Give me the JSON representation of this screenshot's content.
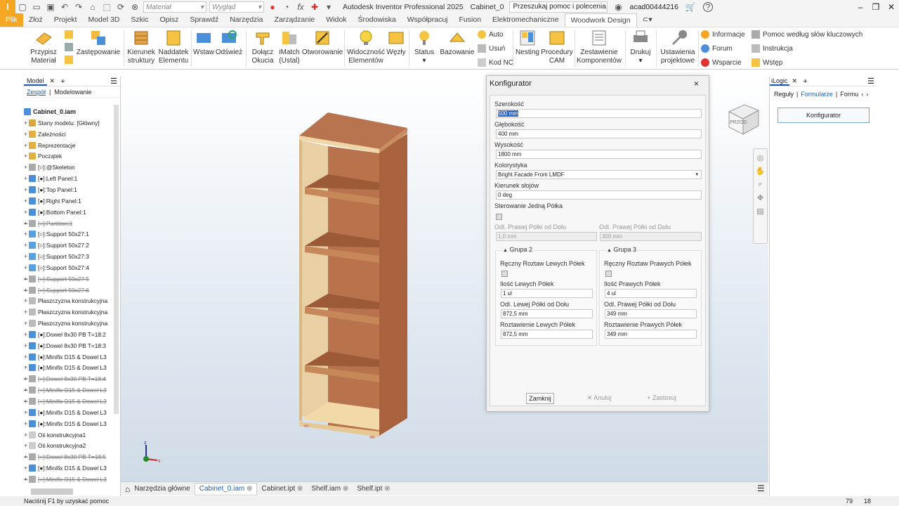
{
  "qat": {
    "logo": "I",
    "material": "Materiał",
    "appearance": "Wygląd",
    "title": "Autodesk Inventor Professional 2025",
    "doc": "Cabinet_0",
    "search": "Przeszukaj pomoc i polecenia...",
    "user": "acad00444216",
    "help": "?"
  },
  "tabs": [
    "Plik",
    "Złoż",
    "Projekt",
    "Model 3D",
    "Szkic",
    "Opisz",
    "Sprawdź",
    "Narzędzia",
    "Zarządzanie",
    "Widok",
    "Środowiska",
    "Współpracuj",
    "Fusion",
    "Elektromechaniczne",
    "Woodwork Design"
  ],
  "ribbon": {
    "przypisz": "Przypisz Materiał",
    "zastepowanie": "Zastępowanie",
    "kierunek": "Kierunek struktury",
    "naddatek": "Naddatek Elementu",
    "wstaw": "Wstaw",
    "odswiez": "Odśwież",
    "dolacz": "Dołącz Okucia",
    "imatch": "iMatch (Ustal)",
    "otworowanie": "Otworowanie",
    "widocznosc": "Widoczność Elementów",
    "wezly": "Węzły",
    "status": "Status",
    "bazowanie": "Bazowanie",
    "auto": "Auto",
    "usun": "Usuń",
    "kodnc": "Kod NC",
    "nesting": "Nesting",
    "procedury": "Procedury CAM",
    "zestawienie": "Zestawienie Komponentów",
    "drukuj": "Drukuj",
    "ustawienia": "Ustawienia projektowe",
    "informacje": "Informacje",
    "forum": "Forum",
    "wsparcie": "Wsparcie",
    "pomoc": "Pomoc według słów kluczowych",
    "instrukcja": "Instrukcja",
    "wstep": "Wstęp"
  },
  "left": {
    "tab": "Model",
    "plus": "+",
    "sub1": "Zespół",
    "sub2": "Modelowanie",
    "root": "Cabinet_0.iam",
    "items": [
      {
        "t": "Stany modelu: [Główny]",
        "s": false,
        "c": "#d8a840"
      },
      {
        "t": "Zależności",
        "s": false,
        "c": "#e0b040"
      },
      {
        "t": "Reprezentacje",
        "s": false,
        "c": "#e0b040"
      },
      {
        "t": "Początek",
        "s": false,
        "c": "#e0b040"
      },
      {
        "t": "[○]:@Skeleton",
        "s": false,
        "c": "#aaa"
      },
      {
        "t": "[●]:Left Panel:1",
        "s": false,
        "c": "#4a8fd8"
      },
      {
        "t": "[●]:Top Panel:1",
        "s": false,
        "c": "#4a8fd8"
      },
      {
        "t": "[●]:Right Panel:1",
        "s": false,
        "c": "#4a8fd8"
      },
      {
        "t": "[●]:Bottom Panel:1",
        "s": false,
        "c": "#4a8fd8"
      },
      {
        "t": "[○]:Partition:1",
        "s": true,
        "c": "#aaa"
      },
      {
        "t": "[○]:Support 50x27:1",
        "s": false,
        "c": "#5aa0e0"
      },
      {
        "t": "[○]:Support 50x27:2",
        "s": false,
        "c": "#5aa0e0"
      },
      {
        "t": "[○]:Support 50x27:3",
        "s": false,
        "c": "#5aa0e0"
      },
      {
        "t": "[○]:Support 50x27:4",
        "s": false,
        "c": "#5aa0e0"
      },
      {
        "t": "[○]:Support 50x27:5",
        "s": true,
        "c": "#aaa"
      },
      {
        "t": "[○]:Support 50x27:6",
        "s": true,
        "c": "#aaa"
      },
      {
        "t": "Płaszczyzna konstrukcyjna",
        "s": false,
        "c": "#bbb"
      },
      {
        "t": "Płaszczyzna konstrukcyjna",
        "s": false,
        "c": "#bbb"
      },
      {
        "t": "Płaszczyzna konstrukcyjna",
        "s": false,
        "c": "#bbb"
      },
      {
        "t": "[●]:Dowel 8x30 PB T=18:2",
        "s": false,
        "c": "#4a8fd8"
      },
      {
        "t": "[●]:Dowel 8x30 PB T=18:3",
        "s": false,
        "c": "#4a8fd8"
      },
      {
        "t": "[●]:Minifix D15 & Dowel L3",
        "s": false,
        "c": "#4a8fd8"
      },
      {
        "t": "[●]:Minifix D15 & Dowel L3",
        "s": false,
        "c": "#4a8fd8"
      },
      {
        "t": "[○]:Dowel 8x30 PB T=18:4",
        "s": true,
        "c": "#aaa"
      },
      {
        "t": "[○]:Minifix D15 & Dowel L3",
        "s": true,
        "c": "#aaa"
      },
      {
        "t": "[○]:Minifix D15 & Dowel L3",
        "s": true,
        "c": "#aaa"
      },
      {
        "t": "[●]:Minifix D15 & Dowel L3",
        "s": false,
        "c": "#4a8fd8"
      },
      {
        "t": "[●]:Minifix D15 & Dowel L3",
        "s": false,
        "c": "#4a8fd8"
      },
      {
        "t": "Oś konstrukcyjna1",
        "s": false,
        "c": "#ccc"
      },
      {
        "t": "Oś konstrukcyjna2",
        "s": false,
        "c": "#ccc"
      },
      {
        "t": "[○]:Dowel 8x30 PB T=18:5",
        "s": true,
        "c": "#aaa"
      },
      {
        "t": "[●]:Minifix D15 & Dowel L3",
        "s": false,
        "c": "#4a8fd8"
      },
      {
        "t": "[○]:Minifix D15 & Dowel L3",
        "s": true,
        "c": "#aaa"
      }
    ]
  },
  "dialog": {
    "title": "Konfigurator",
    "close": "×",
    "szer_l": "Szerokość",
    "szer_v": "500 mm",
    "gleb_l": "Głębokość",
    "gleb_v": "400 mm",
    "wys_l": "Wysokość",
    "wys_v": "1800 mm",
    "kol_l": "Kolorystyka",
    "kol_v": "Bright Facade From LMDF",
    "kier_l": "Kierunek słojów",
    "kier_v": "0 deg",
    "ster_l": "Sterowanie Jedną Półka",
    "odl1_l": "Odl. Prawej Półki od Dołu",
    "odl1_v": "1,0 mm",
    "odl2_l": "Odl. Prawej Półki od Dołu",
    "odl2_v": "300 mm",
    "g2": "Grupa 2",
    "g3": "Grupa 3",
    "g2_rr": "Ręczny Roztaw Lewych Półek",
    "g2_il": "Ilość Lewych Półek",
    "g2_il_v": "1 ul",
    "g2_od": "Odl. Lewej Półki od Dołu",
    "g2_od_v": "872,5 mm",
    "g2_rz": "Roztawienie Lewych Półek",
    "g2_rz_v": "872,5 mm",
    "g3_rr": "Ręczny Roztaw Prawych Półek",
    "g3_il": "Ilość Prawych Półek",
    "g3_il_v": "4 ul",
    "g3_od": "Odl. Prawej Półki od Dołu",
    "g3_od_v": "349 mm",
    "g3_rz": "Roztawienie Prawych Półek",
    "g3_rz_v": "349 mm",
    "zamknij": "Zamknij",
    "anuluj": "Anuluj",
    "zastosuj": "Zastosuj"
  },
  "right": {
    "tab": "iLogic",
    "plus": "+",
    "t1": "Reguły",
    "t2": "Formularze",
    "t3": "Formu",
    "btn": "Konfigurator"
  },
  "viewcube": {
    "label": "PRZÓD"
  },
  "btabs": [
    "Narzędzia główne",
    "Cabinet_0.iam",
    "Cabinet.ipt",
    "Shelf.iam",
    "Shelf.ipt"
  ],
  "status": {
    "text": "Naciśnij F1 by uzyskać pomoc",
    "n1": "79",
    "n2": "18"
  },
  "colors": {
    "accent": "#f5a623",
    "link": "#1a5fb4",
    "wood": "#b5704a",
    "light": "#f1d9a8"
  }
}
